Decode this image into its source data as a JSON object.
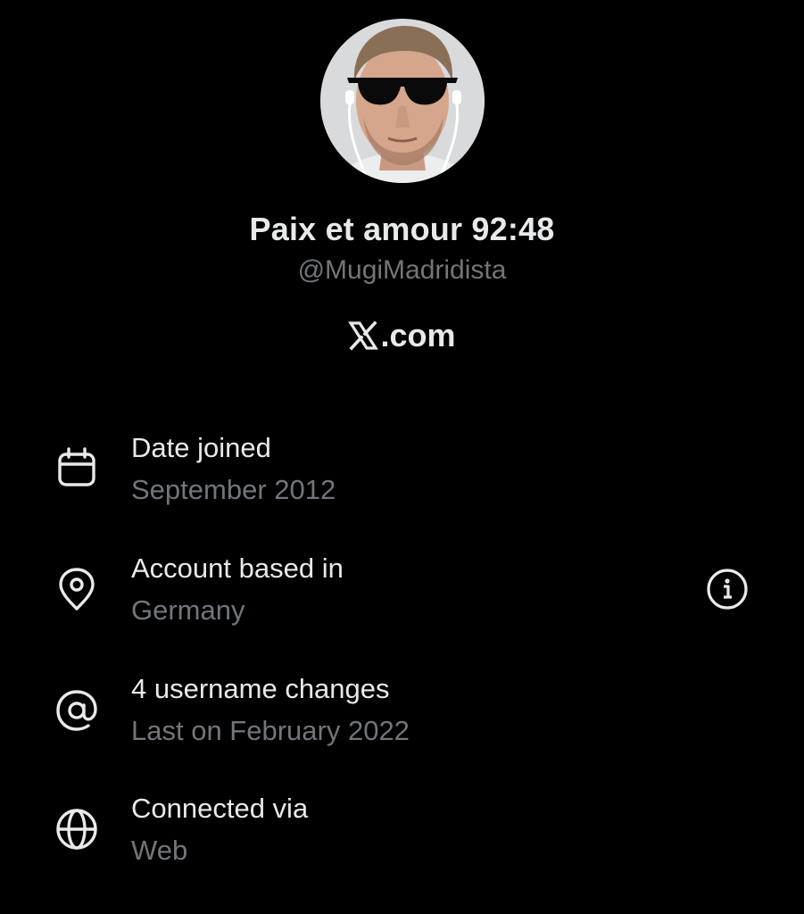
{
  "profile": {
    "display_name": "Paix et amour 92:48",
    "handle": "@MugiMadridista",
    "platform_label": ".com",
    "platform_icon": "x-logo-icon"
  },
  "details": [
    {
      "icon": "calendar-icon",
      "title": "Date joined",
      "subtitle": "September 2012"
    },
    {
      "icon": "location-pin-icon",
      "title": "Account based in",
      "subtitle": "Germany",
      "trailing_icon": "info-icon"
    },
    {
      "icon": "at-sign-icon",
      "title": "4 username changes",
      "subtitle": "Last on February 2022"
    },
    {
      "icon": "globe-icon",
      "title": "Connected via",
      "subtitle": "Web"
    }
  ],
  "colors": {
    "background": "#000000",
    "primary_text": "#e7e9ea",
    "secondary_text": "#71767b"
  }
}
